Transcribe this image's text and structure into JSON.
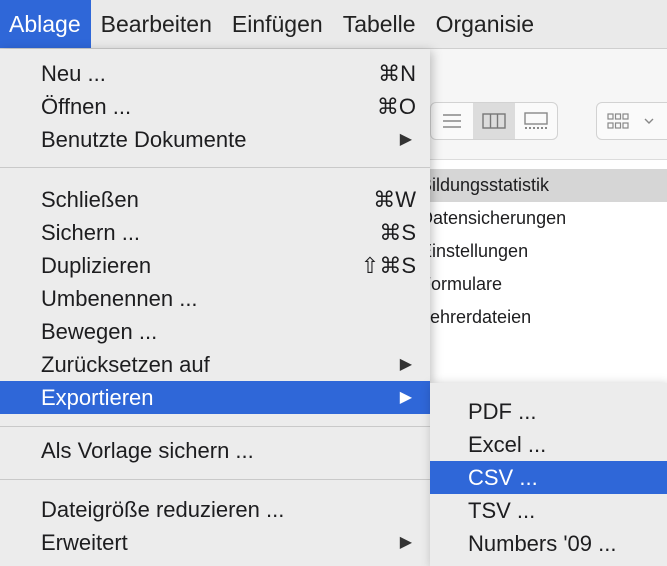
{
  "menubar": {
    "items": [
      "Ablage",
      "Bearbeiten",
      "Einfügen",
      "Tabelle",
      "Organisie"
    ]
  },
  "file_menu": {
    "items": [
      {
        "label": "Neu ...",
        "shortcut": "⌘N"
      },
      {
        "label": "Öffnen ...",
        "shortcut": "⌘O"
      },
      {
        "label": "Benutzte Dokumente",
        "submenu": true
      },
      {
        "label": "Schließen",
        "shortcut": "⌘W"
      },
      {
        "label": "Sichern ...",
        "shortcut": "⌘S"
      },
      {
        "label": "Duplizieren",
        "shortcut": "⇧⌘S"
      },
      {
        "label": "Umbenennen ..."
      },
      {
        "label": "Bewegen ..."
      },
      {
        "label": "Zurücksetzen auf",
        "submenu": true
      },
      {
        "label": "Exportieren",
        "submenu": true,
        "highlighted": true
      },
      {
        "label": "Als Vorlage sichern ..."
      },
      {
        "label": "Dateigröße reduzieren ..."
      },
      {
        "label": "Erweitert",
        "submenu": true
      }
    ],
    "submenu_arrow": "▶"
  },
  "export_submenu": {
    "items": [
      {
        "label": "PDF ..."
      },
      {
        "label": "Excel ..."
      },
      {
        "label": "CSV ...",
        "highlighted": true
      },
      {
        "label": "TSV ..."
      },
      {
        "label": "Numbers '09 ..."
      }
    ]
  },
  "background_window": {
    "list_items": [
      "Bildungsstatistik",
      "Datensicherungen",
      "Einstellungen",
      "Formulare",
      "Lehrerdateien"
    ]
  },
  "colors": {
    "highlight": "#2f67d8",
    "menu_bg": "#ececec"
  }
}
